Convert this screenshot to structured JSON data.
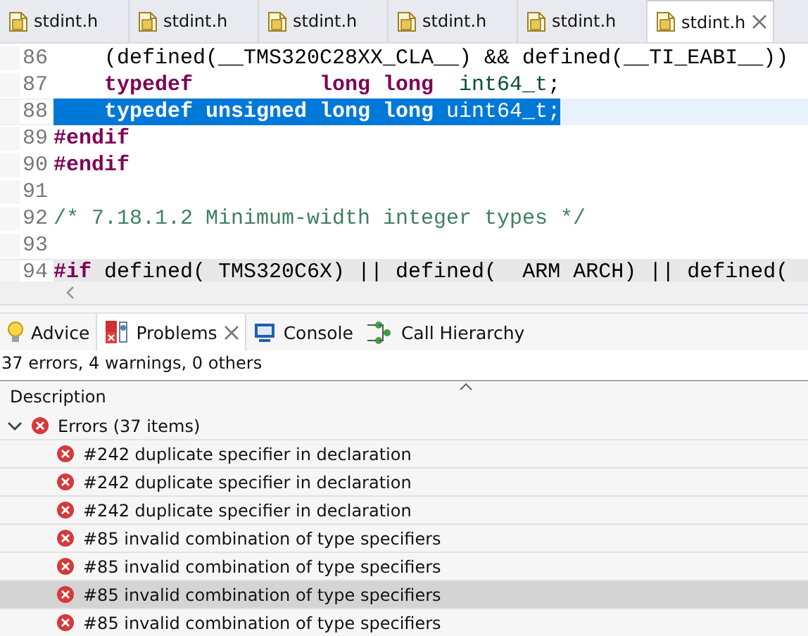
{
  "editor_tabs": [
    {
      "label": "stdint.h",
      "selected": false
    },
    {
      "label": "stdint.h",
      "selected": false
    },
    {
      "label": "stdint.h",
      "selected": false
    },
    {
      "label": "stdint.h",
      "selected": false
    },
    {
      "label": "stdint.h",
      "selected": false
    },
    {
      "label": "stdint.h",
      "selected": true
    }
  ],
  "code_lines": [
    {
      "number": "86",
      "selected": false,
      "current": false,
      "indented": true,
      "segments": [
        {
          "kind": "plain",
          "text": "(defined(__TMS320C28XX_CLA__) && defined(__TI_EABI__))"
        }
      ]
    },
    {
      "number": "87",
      "selected": false,
      "current": false,
      "indented": true,
      "segments": [
        {
          "kind": "keyword",
          "text": "typedef          long long"
        },
        {
          "kind": "type",
          "text": "  int64_t"
        },
        {
          "kind": "plain",
          "text": ";"
        }
      ]
    },
    {
      "number": "88",
      "selected": true,
      "current": false,
      "indented": true,
      "segments": [
        {
          "kind": "keyword",
          "text": "typedef unsigned long long"
        },
        {
          "kind": "type",
          "text": " uint64_t"
        },
        {
          "kind": "plain",
          "text": ";"
        }
      ]
    },
    {
      "number": "89",
      "selected": false,
      "current": false,
      "segments": [
        {
          "kind": "preprocessor",
          "text": "#endif"
        }
      ]
    },
    {
      "number": "90",
      "selected": false,
      "current": false,
      "segments": [
        {
          "kind": "preprocessor",
          "text": "#endif"
        }
      ]
    },
    {
      "number": "91",
      "selected": false,
      "current": false
    },
    {
      "number": "92",
      "selected": false,
      "current": false,
      "segments": [
        {
          "kind": "comment",
          "text": "/* 7.18.1.2 Minimum-width integer types */"
        }
      ]
    },
    {
      "number": "93",
      "selected": false,
      "current": false
    },
    {
      "number": "94",
      "selected": false,
      "current": true,
      "segments": [
        {
          "kind": "preprocessor",
          "text": "#if"
        },
        {
          "kind": "plain",
          "text": " defined( TMS320C6X) || defined(  ARM ARCH) || defined("
        }
      ]
    }
  ],
  "view_tabs": [
    {
      "label": "Advice",
      "kind": "bulb",
      "selected": false,
      "closable": false
    },
    {
      "label": "Problems",
      "kind": "problems",
      "selected": true,
      "closable": true
    },
    {
      "label": "Console",
      "kind": "console",
      "selected": false,
      "closable": false
    },
    {
      "label": "Call Hierarchy",
      "kind": "hierarchy",
      "selected": false,
      "closable": false
    }
  ],
  "summary": "37 errors, 4 warnings, 0 others",
  "table": {
    "columns": [
      "Description"
    ],
    "groups": [
      {
        "label": "Errors (37 items)",
        "expanded": true,
        "children": [
          {
            "label": "#242 duplicate specifier in declaration",
            "selected": false
          },
          {
            "label": "#242 duplicate specifier in declaration",
            "selected": false
          },
          {
            "label": "#242 duplicate specifier in declaration",
            "selected": false
          },
          {
            "label": "#85 invalid combination of type specifiers",
            "selected": false
          },
          {
            "label": "#85 invalid combination of type specifiers",
            "selected": false
          },
          {
            "label": "#85 invalid combination of type specifiers",
            "selected": true
          },
          {
            "label": "#85 invalid combination of type specifiers",
            "selected": false
          }
        ]
      }
    ]
  }
}
